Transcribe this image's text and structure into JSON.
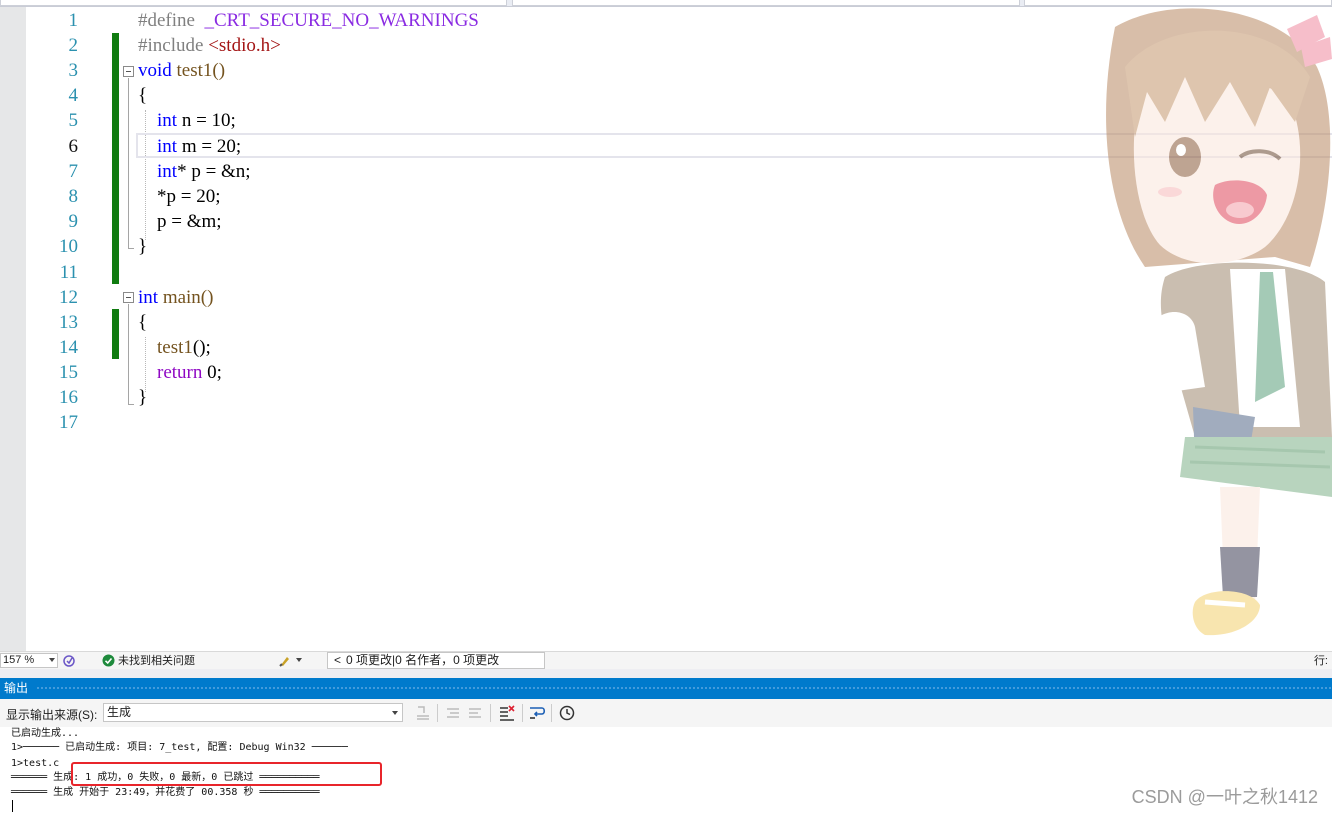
{
  "editor": {
    "line_numbers": [
      "1",
      "2",
      "3",
      "4",
      "5",
      "6",
      "7",
      "8",
      "9",
      "10",
      "11",
      "12",
      "13",
      "14",
      "15",
      "16",
      "17"
    ],
    "current_line": "6",
    "code": {
      "l1": {
        "directive": "#define",
        "macro": "_CRT_SECURE_NO_WARNINGS"
      },
      "l2": {
        "directive": "#include",
        "header": "<stdio.h>"
      },
      "l3": {
        "type": "void",
        "rest": " test1()"
      },
      "l4": {
        "text": "{"
      },
      "l5": {
        "type": "int",
        "rest": " n = ",
        "num": "10",
        "end": ";"
      },
      "l6": {
        "type": "int",
        "rest": " m = ",
        "num": "20",
        "end": ";"
      },
      "l7": {
        "type": "int",
        "rest": "* p = &n;"
      },
      "l8": {
        "rest": "*p = ",
        "num": "20",
        "end": ";"
      },
      "l9": {
        "rest": "p = &m;"
      },
      "l10": {
        "text": "}"
      },
      "l12": {
        "type": "int",
        "rest": " main()"
      },
      "l13": {
        "text": "{"
      },
      "l14": {
        "fn": "test1",
        "rest": "();"
      },
      "l15": {
        "kw": "return",
        "num": "0",
        "end": ";"
      },
      "l16": {
        "text": "}"
      }
    }
  },
  "status": {
    "zoom": "157 %",
    "issues": "未找到相关问题",
    "changes": "0 项更改|0 名作者，0 项更改",
    "line_label": "行:"
  },
  "output": {
    "title": "输出",
    "source_label": "显示输出来源(S):",
    "source_value": "生成",
    "lines": [
      "已启动生成...",
      "1>────── 已启动生成: 项目: 7_test, 配置: Debug Win32 ──────",
      "1>test.c",
      "══════ 生成: 1 成功，0 失败，0 最新，0 已跳过 ══════════",
      "══════ 生成 开始于 23:49，并花费了 00.358 秒 ══════════"
    ]
  },
  "watermark": "CSDN @一叶之秋1412",
  "colors": {
    "keyword": "#0000ff",
    "macro": "#8a2be2",
    "line_number": "#2b91af",
    "change_bar": "#107c10",
    "output_title_bg": "#007acc",
    "highlight_box": "#e8252b"
  }
}
